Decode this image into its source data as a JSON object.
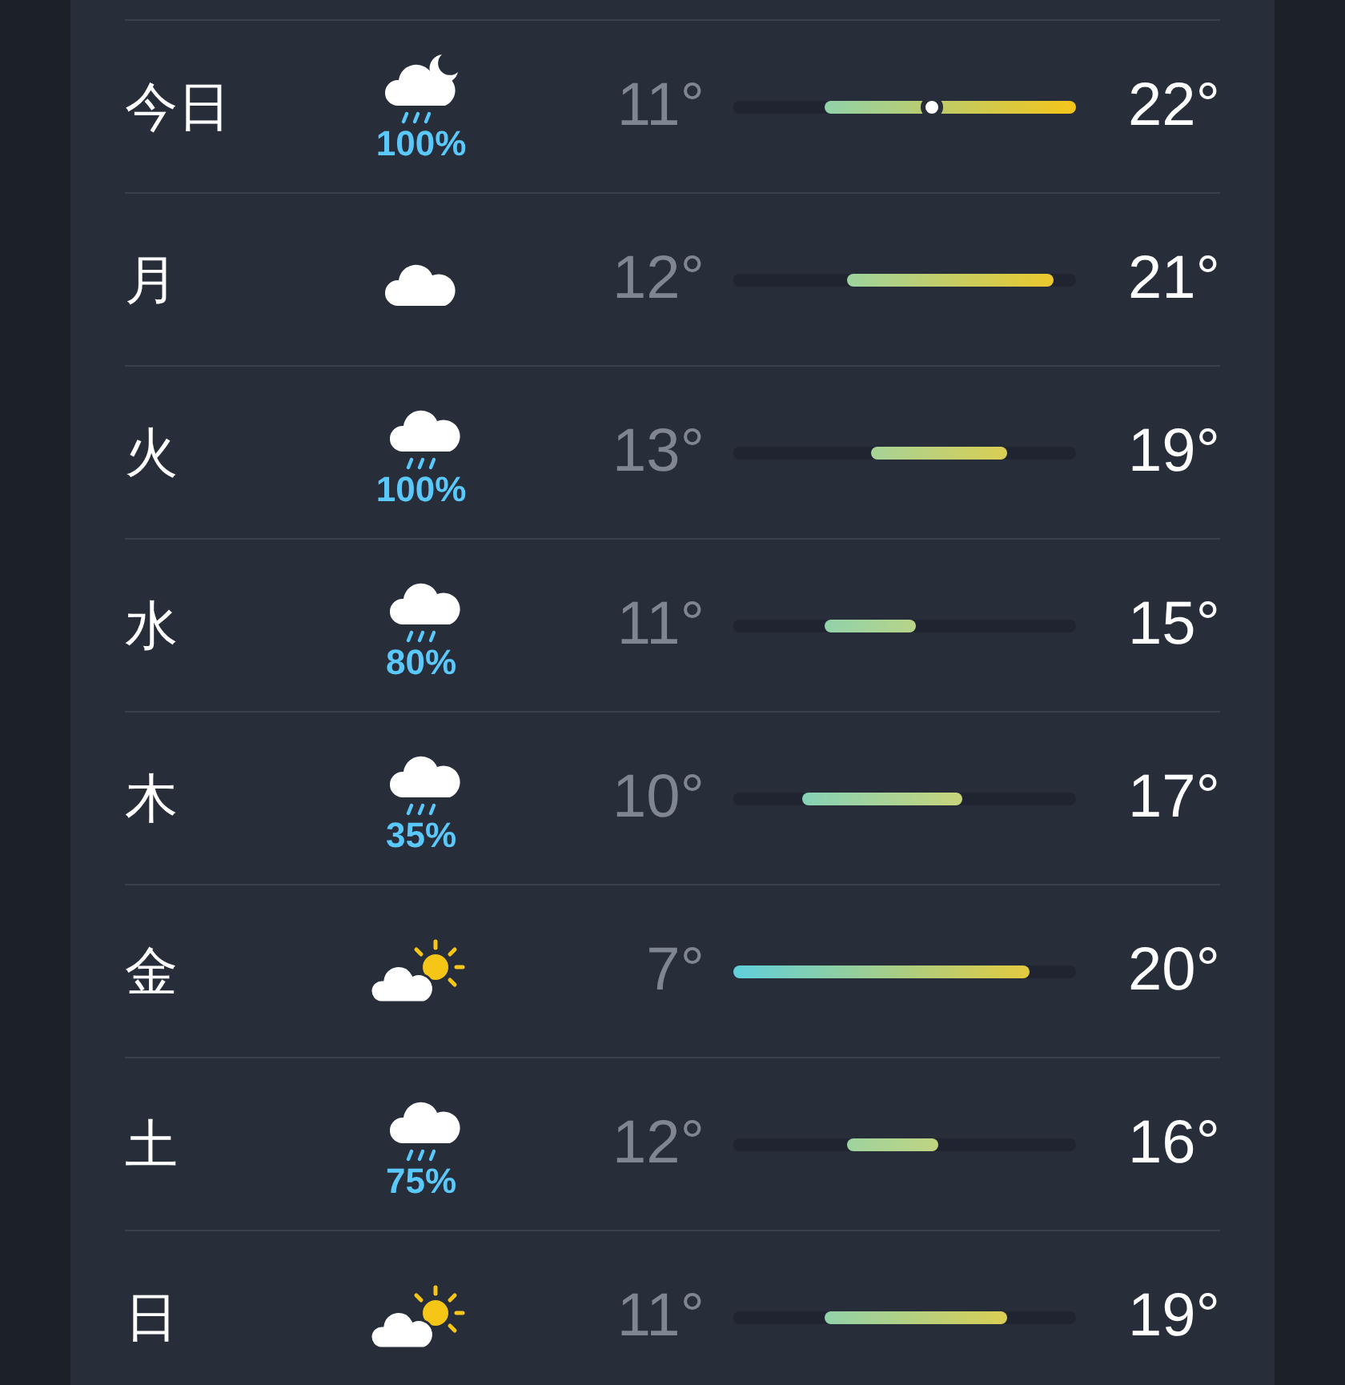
{
  "days": [
    {
      "day": "今日",
      "kind": "night-rain",
      "precip": "100%",
      "low": "11°",
      "high": "22°",
      "current": {
        "level": 0.58
      }
    },
    {
      "day": "月",
      "kind": "cloud",
      "low": "12°",
      "high": "21°"
    },
    {
      "day": "火",
      "kind": "rain",
      "precip": "100%",
      "low": "13°",
      "high": "19°"
    },
    {
      "day": "水",
      "kind": "rain",
      "precip": "80%",
      "low": "11°",
      "high": "15°"
    },
    {
      "day": "木",
      "kind": "rain",
      "precip": "35%",
      "low": "10°",
      "high": "17°"
    },
    {
      "day": "金",
      "kind": "partly-sunny",
      "low": "7°",
      "high": "20°"
    },
    {
      "day": "土",
      "kind": "rain",
      "precip": "75%",
      "low": "12°",
      "high": "16°"
    },
    {
      "day": "日",
      "kind": "partly-sunny",
      "low": "11°",
      "high": "19°"
    }
  ]
}
